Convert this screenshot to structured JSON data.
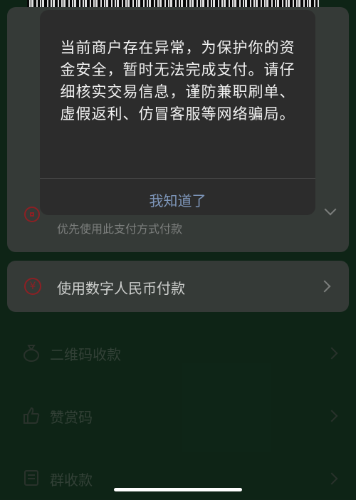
{
  "dialog": {
    "message": "当前商户存在异常，为保护你的资金安全，暂时无法完成支付。请仔细核实交易信息，谨防兼职刷单、虚假返利、仿冒客服等网络骗局。",
    "confirm_label": "我知道了"
  },
  "payment": {
    "bank_subtitle": "优先使用此支付方式付款",
    "ecny_label": "使用数字人民币付款"
  },
  "list": {
    "items": [
      {
        "label": "二维码收款",
        "icon": "money-bag-icon"
      },
      {
        "label": "赞赏码",
        "icon": "thumbs-up-icon"
      },
      {
        "label": "群收款",
        "icon": "group-receipt-icon"
      }
    ]
  },
  "colors": {
    "modal_bg": "#2c2c2c",
    "link_blue": "#7d95b8",
    "brand_red": "#a0252a",
    "card_bg": "#3d423f",
    "page_bg": "#102a1a"
  }
}
